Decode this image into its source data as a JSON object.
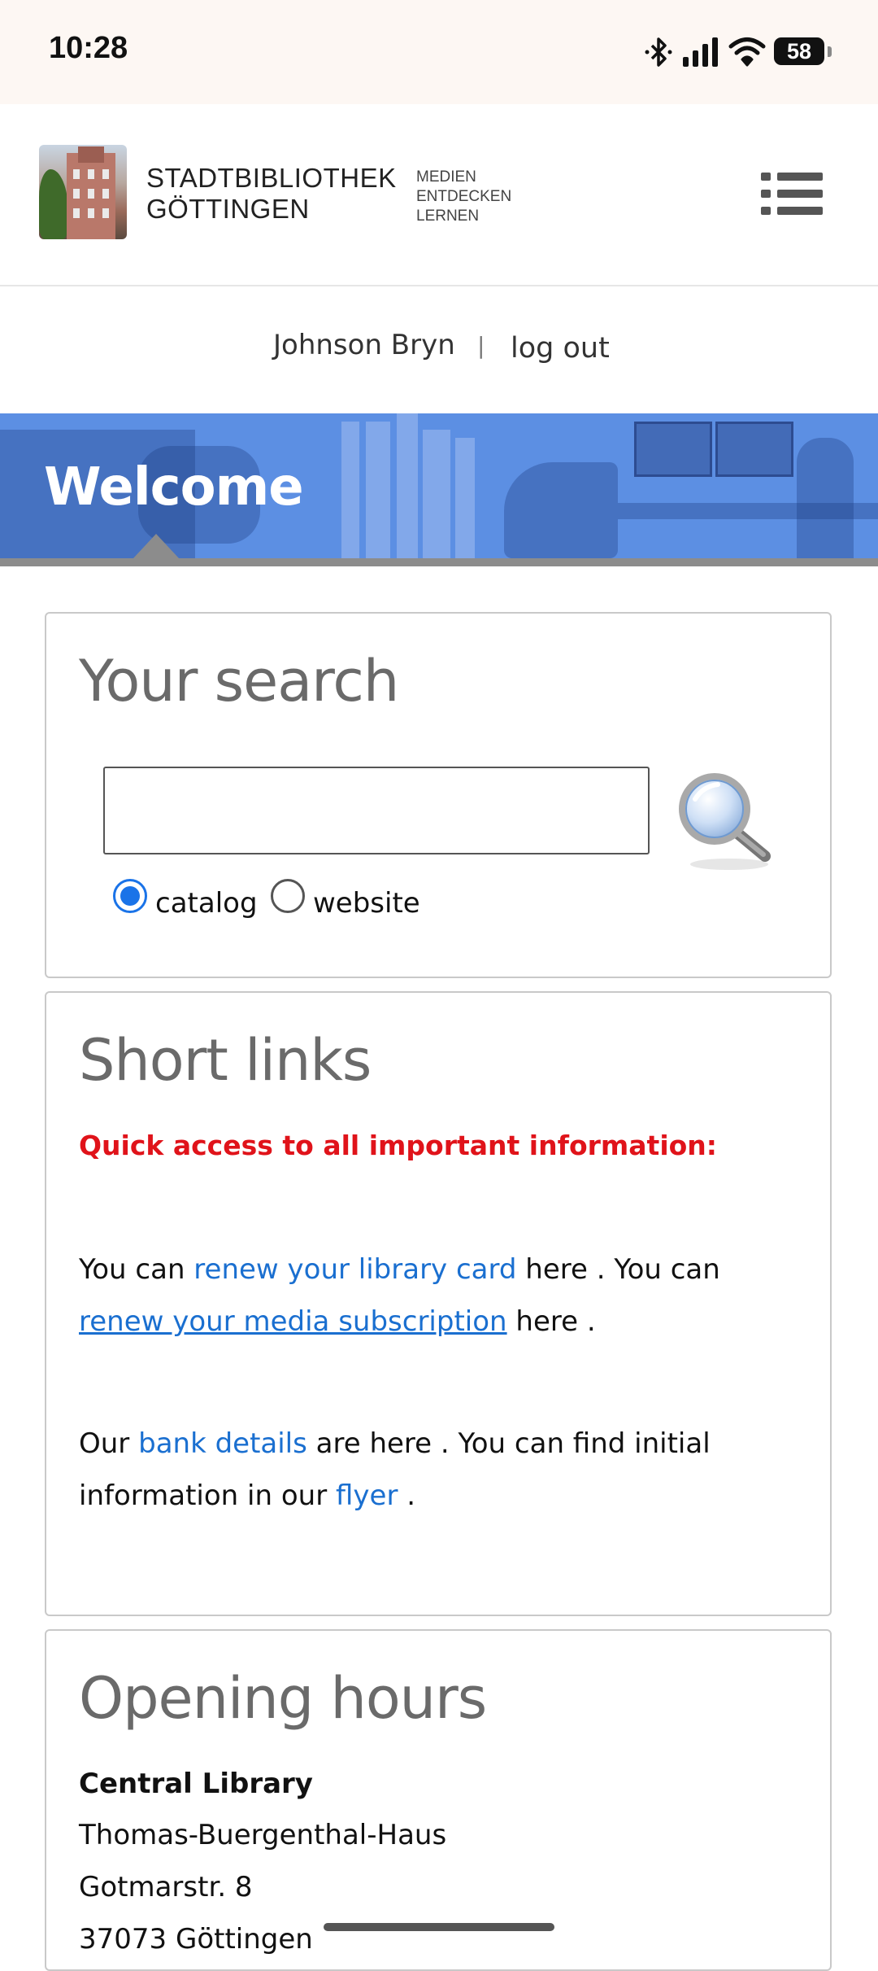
{
  "status_bar": {
    "time": "10:28",
    "battery": "58",
    "icons": [
      "bluetooth-icon",
      "signal-icon",
      "wifi-icon",
      "battery-icon"
    ]
  },
  "header": {
    "brand_line1": "STADTBIBLIOTHEK",
    "brand_line2": "GÖTTINGEN",
    "tagline": [
      "MEDIEN",
      "ENTDECKEN",
      "LERNEN"
    ],
    "menu_icon": "hamburger-list-icon"
  },
  "user": {
    "name": "Johnson Bryn",
    "separator": "|",
    "logout_label": "log out"
  },
  "banner": {
    "title": "Welcome"
  },
  "search": {
    "heading": "Your search",
    "input_value": "",
    "button_icon": "magnifier-icon",
    "options": [
      {
        "label": "catalog",
        "checked": true
      },
      {
        "label": "website",
        "checked": false
      }
    ]
  },
  "short_links": {
    "heading": "Short links",
    "quick_access": "Quick access to all important information:",
    "p1": {
      "t1": "You can ",
      "link1": "renew your library card",
      "t2": " here . You can ",
      "link2": "renew your media subscription",
      "t3": " here ."
    },
    "p2": {
      "t1": "Our ",
      "link1": "bank details",
      "t2": " are here . You can find initial information in our ",
      "link2": "flyer",
      "t3": " ."
    }
  },
  "opening_hours": {
    "heading": "Opening hours",
    "location_name": "Central Library",
    "lines": [
      "Thomas-Buergenthal-Haus",
      "Gotmarstr. 8",
      "37073 Göttingen"
    ]
  },
  "colors": {
    "accent_blue": "#1a73e8",
    "link_blue": "#1a6fd0",
    "alert_red": "#e0131a",
    "banner_blue": "#5c8fe3"
  }
}
